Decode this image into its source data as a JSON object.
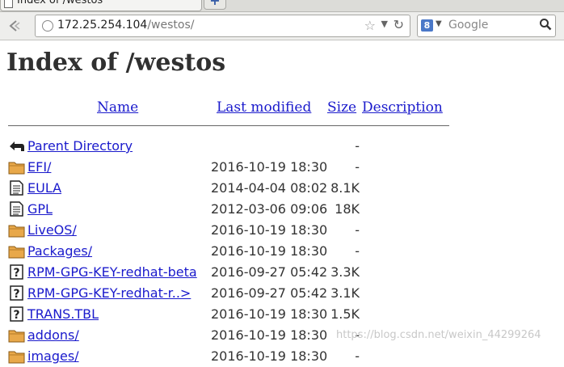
{
  "browser": {
    "tab_title": "Index of /westos",
    "new_tab_symbol": "+",
    "url_host": "172.25.254.104",
    "url_path": "/westos/",
    "search_placeholder": "Google",
    "search_engine_letter": "8"
  },
  "page": {
    "title": "Index of /westos",
    "columns": {
      "name": "Name",
      "last_modified": "Last modified",
      "size": "Size",
      "description": "Description"
    },
    "rows": [
      {
        "icon": "back-arrow-icon",
        "name": "Parent Directory",
        "date": "",
        "size": "-"
      },
      {
        "icon": "folder-icon",
        "name": "EFI/",
        "date": "2016-10-19 18:30",
        "size": "-"
      },
      {
        "icon": "text-file-icon",
        "name": "EULA",
        "date": "2014-04-04 08:02",
        "size": "8.1K"
      },
      {
        "icon": "text-file-icon",
        "name": "GPL",
        "date": "2012-03-06 09:06",
        "size": "18K"
      },
      {
        "icon": "folder-icon",
        "name": "LiveOS/",
        "date": "2016-10-19 18:30",
        "size": "-"
      },
      {
        "icon": "folder-icon",
        "name": "Packages/",
        "date": "2016-10-19 18:30",
        "size": "-"
      },
      {
        "icon": "unknown-file-icon",
        "name": "RPM-GPG-KEY-redhat-beta",
        "date": "2016-09-27 05:42",
        "size": "3.3K"
      },
      {
        "icon": "unknown-file-icon",
        "name": "RPM-GPG-KEY-redhat-r..>",
        "date": "2016-09-27 05:42",
        "size": "3.1K"
      },
      {
        "icon": "unknown-file-icon",
        "name": "TRANS.TBL",
        "date": "2016-10-19 18:30",
        "size": "1.5K"
      },
      {
        "icon": "folder-icon",
        "name": "addons/",
        "date": "2016-10-19 18:30",
        "size": "-"
      },
      {
        "icon": "folder-icon",
        "name": "images/",
        "date": "2016-10-19 18:30",
        "size": "-"
      }
    ]
  },
  "watermark": "https://blog.csdn.net/weixin_44299264",
  "colors": {
    "link": "#1a1acc",
    "heading": "#303030",
    "folder": "#e8a84a"
  }
}
